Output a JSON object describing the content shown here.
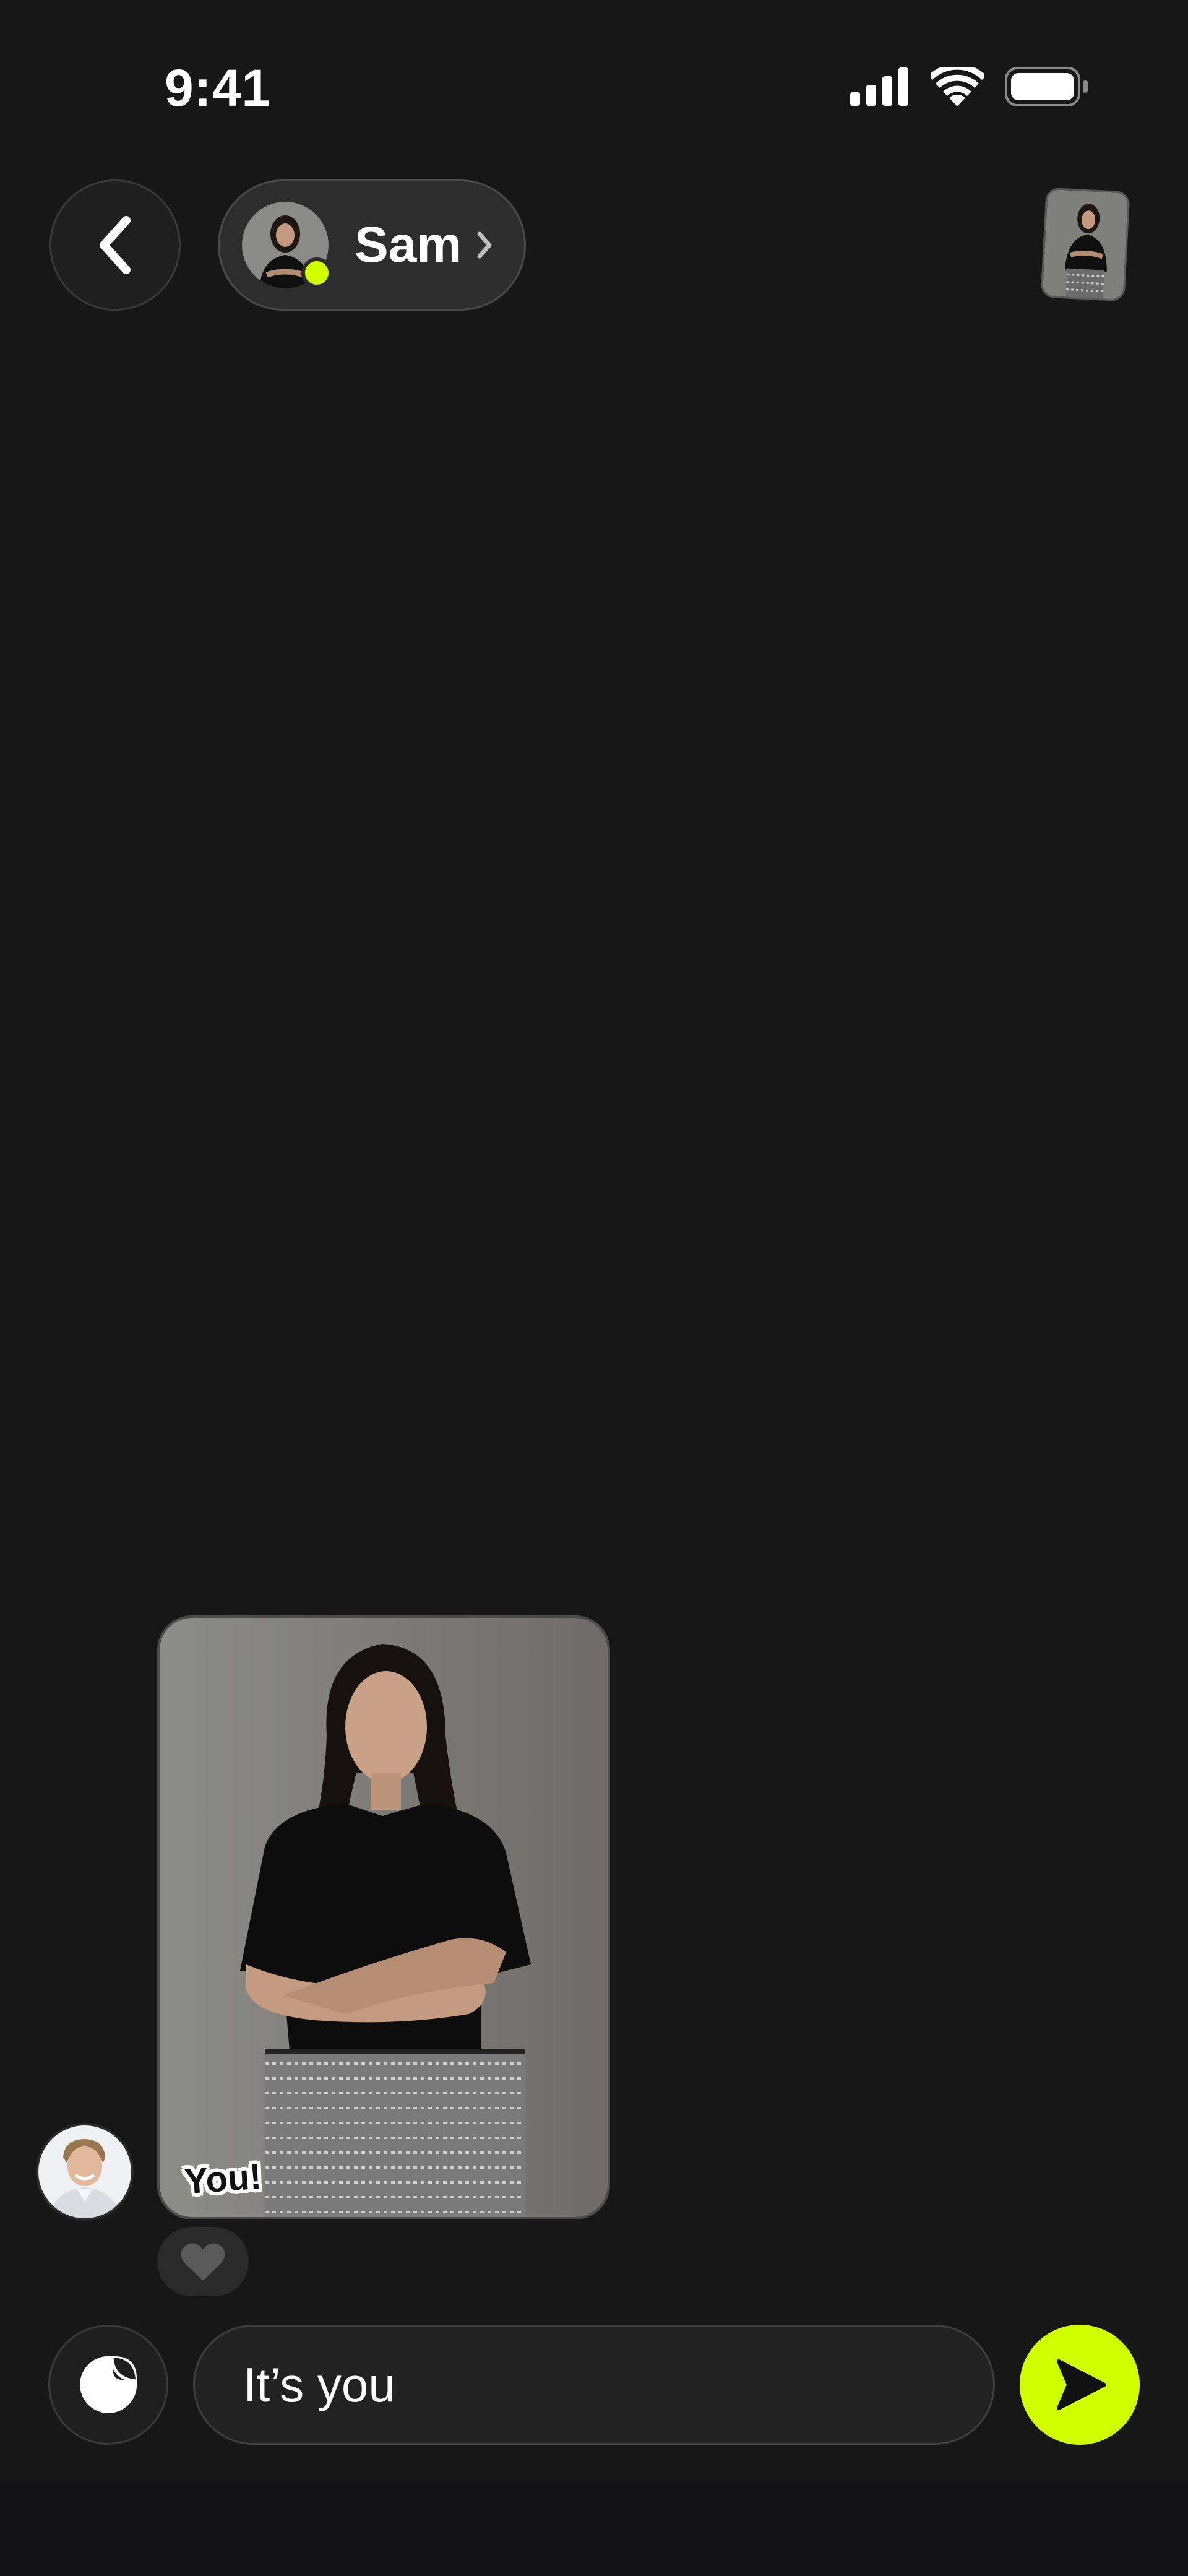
{
  "status_bar": {
    "time": "9:41"
  },
  "header": {
    "contact_name": "Sam",
    "online": true
  },
  "message": {
    "sticker_text": "You!"
  },
  "composer": {
    "input_value": "It’s you"
  },
  "colors": {
    "background": "#171718",
    "accent": "#d2ff00",
    "pill_background": "#2d2d2e"
  },
  "icons": {
    "back": "chevron-left-icon",
    "contact_chevron": "chevron-right-icon",
    "signal": "cellular-signal-icon",
    "wifi": "wifi-icon",
    "battery": "battery-icon",
    "heart": "heart-icon",
    "sticker": "sticker-icon",
    "send": "send-icon"
  }
}
